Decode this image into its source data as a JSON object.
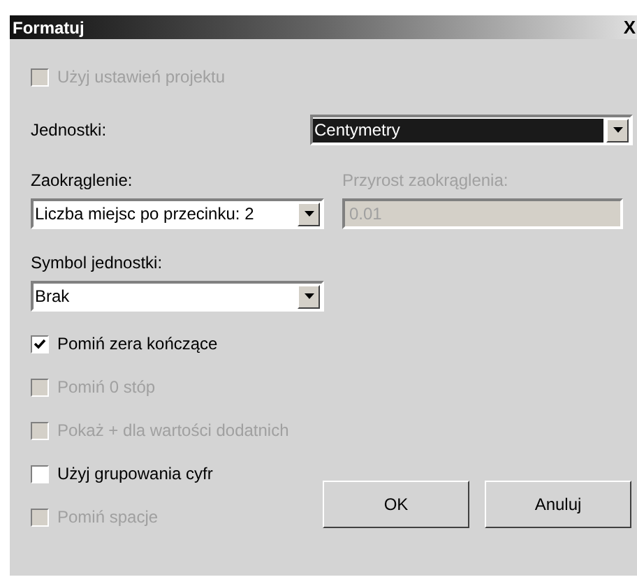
{
  "window": {
    "title": "Formatuj",
    "close": "X"
  },
  "use_project_settings": {
    "label": "Użyj ustawień projektu",
    "checked": false,
    "disabled": true
  },
  "units": {
    "label": "Jednostki:",
    "value": "Centymetry",
    "focused": true
  },
  "rounding": {
    "label": "Zaokrąglenie:",
    "value": "Liczba miejsc po przecinku: 2"
  },
  "rounding_increment": {
    "label": "Przyrost zaokrąglenia:",
    "value": "0.01",
    "disabled": true
  },
  "unit_symbol": {
    "label": "Symbol jednostki:",
    "value": "Brak"
  },
  "options": [
    {
      "label": "Pomiń zera kończące",
      "checked": true,
      "disabled": false
    },
    {
      "label": "Pomiń 0 stóp",
      "checked": false,
      "disabled": true
    },
    {
      "label": "Pokaż + dla wartości dodatnich",
      "checked": false,
      "disabled": true
    },
    {
      "label": "Użyj grupowania cyfr",
      "checked": false,
      "disabled": false
    },
    {
      "label": "Pomiń spacje",
      "checked": false,
      "disabled": true
    }
  ],
  "buttons": [
    "OK",
    "Anuluj"
  ]
}
